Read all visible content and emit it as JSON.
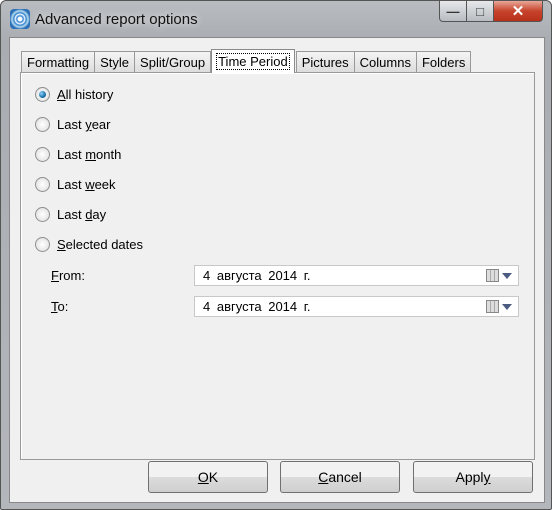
{
  "window": {
    "title": "Advanced report options",
    "minimize": "—",
    "maximize": "□",
    "close": "✕"
  },
  "tabs": [
    "Formatting",
    "Style",
    "Split/Group",
    "Time Period",
    "Pictures",
    "Columns",
    "Folders"
  ],
  "active_tab": "Time Period",
  "options": [
    {
      "pre": "",
      "key": "A",
      "post": "ll history",
      "selected": true
    },
    {
      "pre": "Last ",
      "key": "y",
      "post": "ear",
      "selected": false
    },
    {
      "pre": "Last ",
      "key": "m",
      "post": "onth",
      "selected": false
    },
    {
      "pre": "Last ",
      "key": "w",
      "post": "eek",
      "selected": false
    },
    {
      "pre": "Last ",
      "key": "d",
      "post": "ay",
      "selected": false
    },
    {
      "pre": "",
      "key": "S",
      "post": "elected dates",
      "selected": false
    }
  ],
  "from": {
    "pre": "",
    "key": "F",
    "post": "rom:",
    "value": "4 августа 2014 г."
  },
  "to": {
    "pre": "",
    "key": "T",
    "post": "o:",
    "value": "4 августа 2014 г."
  },
  "buttons": {
    "ok": {
      "pre": "",
      "key": "O",
      "post": "K"
    },
    "cancel": {
      "pre": "",
      "key": "C",
      "post": "ancel"
    },
    "apply": {
      "pre": "Appl",
      "key": "y",
      "post": ""
    }
  }
}
